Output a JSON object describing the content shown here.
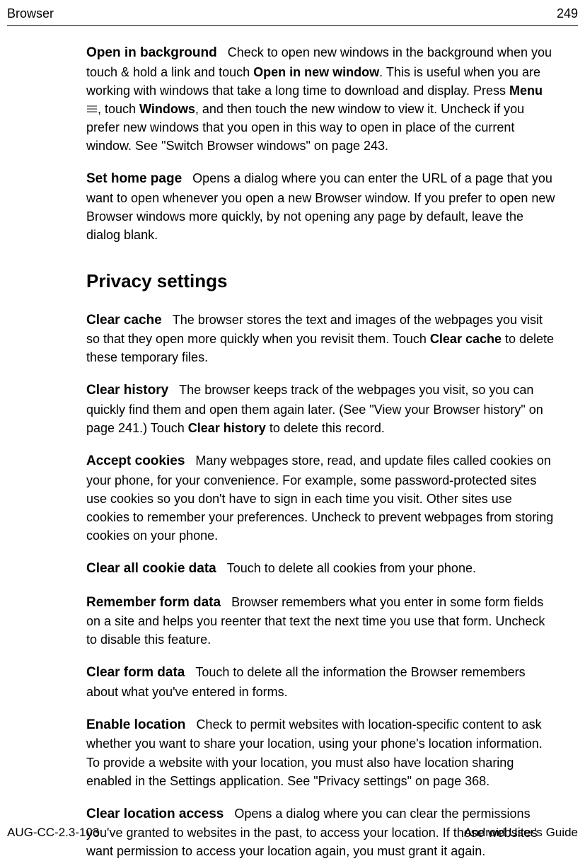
{
  "header": {
    "section": "Browser",
    "page_number": "249"
  },
  "content": {
    "para1": {
      "lead": "Open in background",
      "text1": "Check to open new windows in the background when you touch & hold a link and touch ",
      "bold1": "Open in new window",
      "text2": ". This is useful when you are working with windows that take a long time to download and display. Press ",
      "bold2": "Menu",
      "text3": ", touch ",
      "bold3": "Windows",
      "text4": ", and then touch the new window to view it. Uncheck if you prefer new windows that you open in this way to open in place of the current window. See \"Switch Browser windows\" on page 243."
    },
    "para2": {
      "lead": "Set home page",
      "text": "Opens a dialog where you can enter the URL of a page that you want to open whenever you open a new Browser window. If you prefer to open new Browser windows more quickly, by not opening any page by default, leave the dialog blank."
    },
    "section_heading": "Privacy settings",
    "para3": {
      "lead": "Clear cache",
      "text1": "The browser stores the text and images of the webpages you visit so that they open more quickly when you revisit them. Touch ",
      "bold1": "Clear cache",
      "text2": " to delete these temporary files."
    },
    "para4": {
      "lead": "Clear history",
      "text1": "The browser keeps track of the webpages you visit, so you can quickly find them and open them again later. (See \"View your Browser history\" on page 241.) Touch ",
      "bold1": "Clear history",
      "text2": " to delete this record."
    },
    "para5": {
      "lead": "Accept cookies",
      "text": "Many webpages store, read, and update files called cookies on your phone, for your convenience. For example, some password-protected sites use cookies so you don't have to sign in each time you visit. Other sites use cookies to remember your preferences. Uncheck to prevent webpages from storing cookies on your phone."
    },
    "para6": {
      "lead": "Clear all cookie data",
      "text": "Touch to delete all cookies from your phone."
    },
    "para7": {
      "lead": "Remember form data",
      "text": "Browser remembers what you enter in some form fields on a site and helps you reenter that text the next time you use that form. Uncheck to disable this feature."
    },
    "para8": {
      "lead": "Clear form data",
      "text": "Touch to delete all the information the Browser remembers about what you've entered in forms."
    },
    "para9": {
      "lead": "Enable location",
      "text": "Check to permit websites with location-specific content to ask whether you want to share your location, using your phone's location information. To provide a website with your location, you must also have location sharing enabled in the Settings application. See \"Privacy settings\" on page 368."
    },
    "para10": {
      "lead": "Clear location access",
      "text": "Opens a dialog where you can clear the permissions you've granted to websites in the past, to access your location. If those websites want permission to access your location again, you must grant it again."
    }
  },
  "footer": {
    "doc_id": "AUG-CC-2.3-103",
    "guide_name": "Android User's Guide"
  }
}
